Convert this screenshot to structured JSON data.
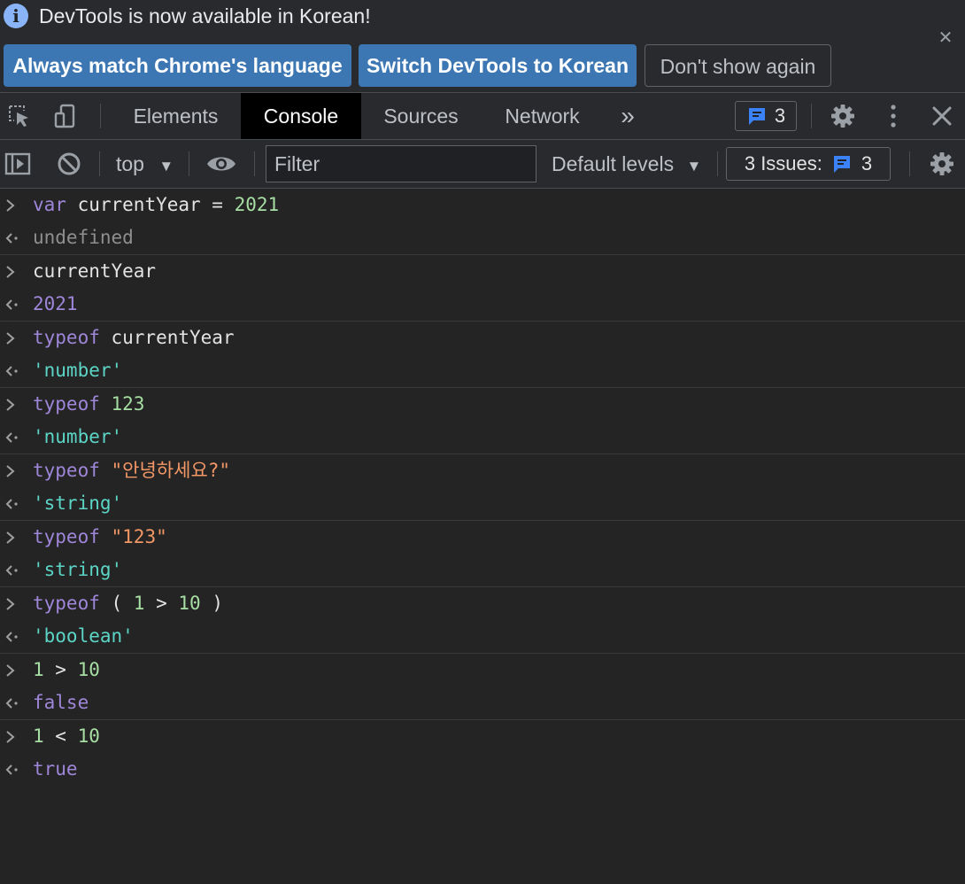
{
  "infobar": {
    "message": "DevTools is now available in Korean!",
    "btn_match": "Always match Chrome's language",
    "btn_switch": "Switch DevTools to Korean",
    "btn_dont_show": "Don't show again"
  },
  "tabs": {
    "elements": "Elements",
    "console": "Console",
    "sources": "Sources",
    "network": "Network",
    "more": "»"
  },
  "badge": {
    "messages_count": "3"
  },
  "toolbar": {
    "context": "top",
    "filter_placeholder": "Filter",
    "levels": "Default levels",
    "issues_label": "3 Issues:",
    "issues_count": "3"
  },
  "console": {
    "entries": [
      {
        "input": [
          "var",
          " currentYear = ",
          "2021"
        ],
        "output": "undefined"
      },
      {
        "input": [
          "currentYear"
        ],
        "output": "2021"
      },
      {
        "input": [
          "typeof",
          " currentYear"
        ],
        "output": "'number'"
      },
      {
        "input": [
          "typeof",
          " ",
          "123"
        ],
        "output": "'number'"
      },
      {
        "input": [
          "typeof",
          " ",
          "\"안녕하세요?\""
        ],
        "output": "'string'"
      },
      {
        "input": [
          "typeof",
          " ",
          "\"123\""
        ],
        "output": "'string'"
      },
      {
        "input": [
          "typeof",
          " ( ",
          "1",
          " > ",
          "10",
          " )"
        ],
        "output": "'boolean'"
      },
      {
        "input": [
          "1",
          " > ",
          "10"
        ],
        "output": "false"
      },
      {
        "input": [
          "1",
          " < ",
          "10"
        ],
        "output": "true"
      }
    ]
  }
}
